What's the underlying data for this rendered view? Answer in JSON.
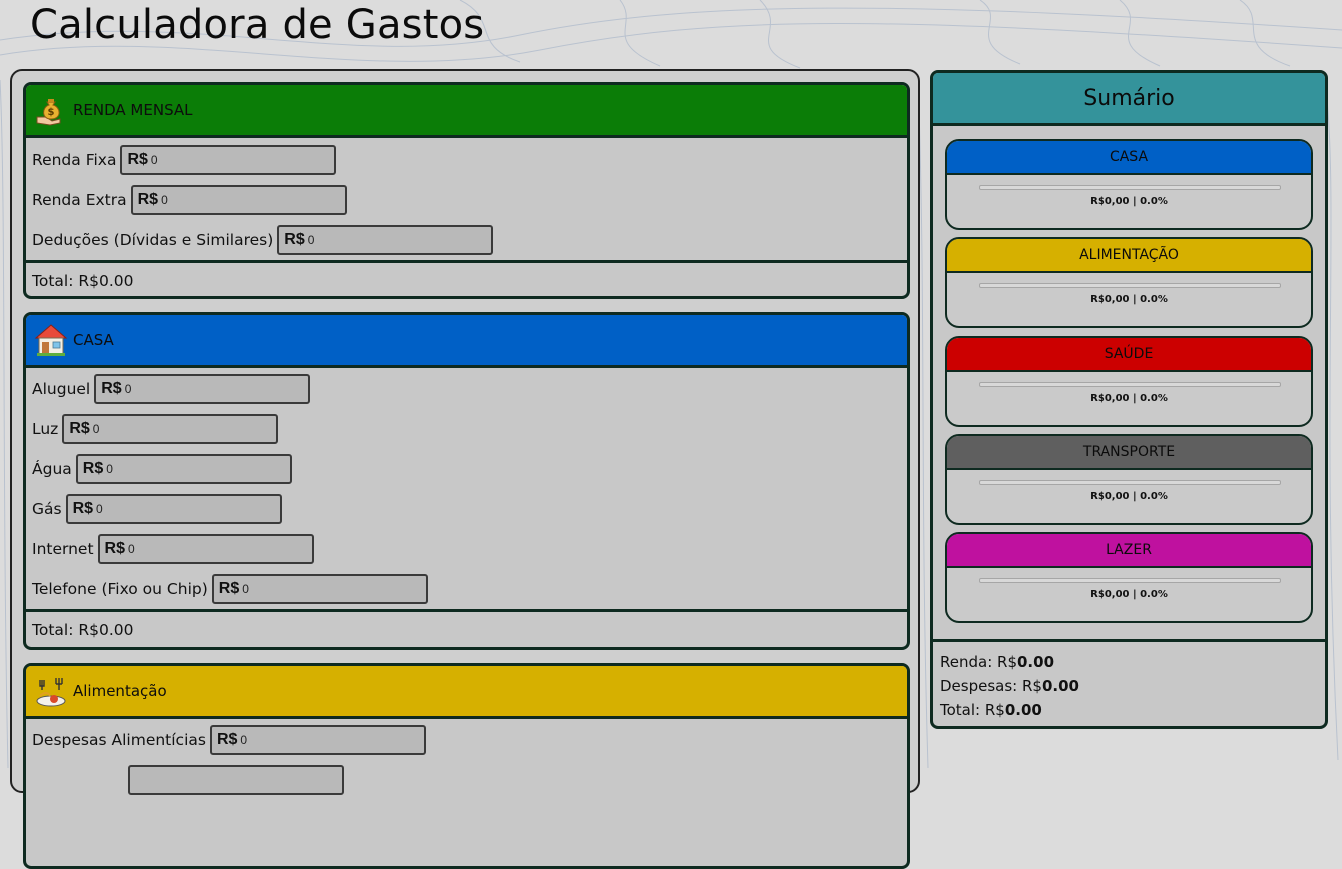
{
  "page": {
    "title": "Calculadora de Gastos"
  },
  "currency_prefix": "R$",
  "sections": {
    "renda": {
      "title": "RENDA MENSAL",
      "color": "#0b7d07",
      "icon": "money-bag-icon",
      "fields": [
        {
          "label": "Renda Fixa",
          "value": "0"
        },
        {
          "label": "Renda Extra",
          "value": "0"
        },
        {
          "label": "Deduções (Dívidas e Similares)",
          "value": "0"
        }
      ],
      "total": "Total: R$0.00"
    },
    "casa": {
      "title": "CASA",
      "color": "#0060c6",
      "icon": "house-icon",
      "fields": [
        {
          "label": "Aluguel",
          "value": "0"
        },
        {
          "label": "Luz",
          "value": "0"
        },
        {
          "label": "Água",
          "value": "0"
        },
        {
          "label": "Gás",
          "value": "0"
        },
        {
          "label": "Internet",
          "value": "0"
        },
        {
          "label": "Telefone (Fixo ou Chip)",
          "value": "0"
        }
      ],
      "total": "Total: R$0.00"
    },
    "alimentacao": {
      "title": "Alimentação",
      "color": "#d6b000",
      "icon": "food-icon",
      "fields": [
        {
          "label": "Despesas Alimentícias",
          "value": "0"
        }
      ]
    }
  },
  "summary": {
    "title": "Sumário",
    "header_color": "#34939b",
    "cards": [
      {
        "name": "CASA",
        "color": "#0060c6",
        "value_text": "R$0,00 | 0.0%",
        "percent": 0
      },
      {
        "name": "ALIMENTAÇÃO",
        "color": "#d6b000",
        "value_text": "R$0,00 | 0.0%",
        "percent": 0
      },
      {
        "name": "SAÚDE",
        "color": "#cc0000",
        "value_text": "R$0,00 | 0.0%",
        "percent": 0
      },
      {
        "name": "TRANSPORTE",
        "color": "#5f5f5f",
        "value_text": "R$0,00 | 0.0%",
        "percent": 0
      },
      {
        "name": "LAZER",
        "color": "#bf119f",
        "value_text": "R$0,00 | 0.0%",
        "percent": 0
      }
    ],
    "renda_label": "Renda: R$",
    "renda_value": "0.00",
    "despesas_label": "Despesas: R$",
    "despesas_value": "0.00",
    "total_label": "Total: R$",
    "total_value": "0.00"
  }
}
